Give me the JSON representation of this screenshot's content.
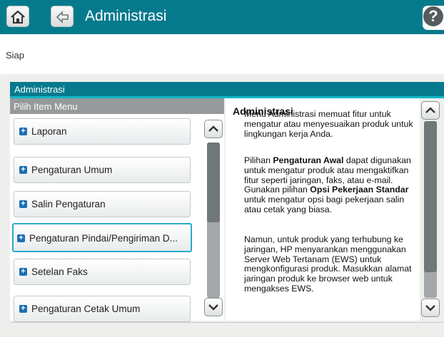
{
  "header": {
    "title": "Administrasi",
    "home_icon": "home-icon",
    "back_icon": "back-arrow-icon",
    "help_label": "?",
    "bar_color": "#067a8d"
  },
  "status": {
    "text": "Siap"
  },
  "panel": {
    "title": "Administrasi",
    "list_header": "Pilih Item Menu",
    "items": [
      {
        "label": "Laporan"
      },
      {
        "label": "Pengaturan Umum"
      },
      {
        "label": "Salin Pengaturan"
      },
      {
        "label": "Pengaturan Pindai/Pengiriman D..."
      },
      {
        "label": "Setelan Faks"
      },
      {
        "label": "Pengaturan Cetak Umum"
      }
    ],
    "selected_item": "Pengaturan Pindai/Pengiriman D..."
  },
  "description": {
    "heading": "Administrasi",
    "para1": "Menu Administrasi memuat fitur untuk mengatur atau menyesuaikan produk untuk lingkungan kerja Anda.",
    "para2_a": "Pilihan ",
    "para2_b": "Pengaturan Awal",
    "para2_c": " dapat digunakan untuk mengatur produk atau mengaktifkan fitur seperti jaringan, faks, atau e-mail. Gunakan pilihan ",
    "para2_d": "Opsi Pekerjaan Standar",
    "para2_e": " untuk mengatur opsi bagi pekerjaan salin atau cetak yang biasa.",
    "para3": "Namun, untuk produk yang terhubung ke jaringan, HP menyarankan menggunakan Server Web Tertanam (EWS) untuk mengkonfigurasi produk. Masukkan alamat jaringan produk ke browser web untuk mengakses EWS."
  }
}
